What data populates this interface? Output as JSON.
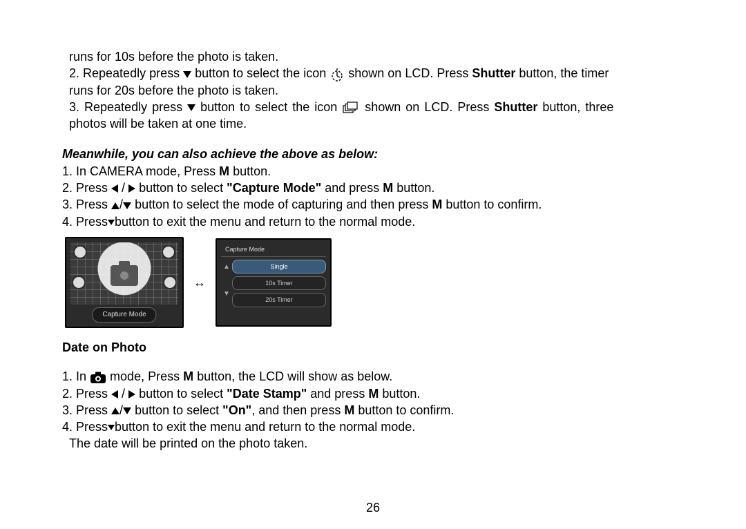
{
  "page_number": "26",
  "intro": {
    "cont1": "runs for 10s before the photo is taken.",
    "item2_a": "2. Repeatedly press ",
    "item2_b": " button to select the icon ",
    "item2_c": " shown on LCD. Press ",
    "item2_shutter": "Shutter",
    "item2_d": " button, the timer",
    "item2_e": "runs for 20s before the photo is taken.",
    "item3_a": "3. Repeatedly press ",
    "item3_b": " button to select the icon ",
    "item3_c": " shown on LCD. Press ",
    "item3_shutter": "Shutter",
    "item3_d": " button, three",
    "item3_e": "photos will be taken at one time."
  },
  "meanwhile_heading": "Meanwhile, you can also achieve the above as below:",
  "meanwhile": {
    "i1_a": "1. In CAMERA mode, Press ",
    "i1_m": "M",
    "i1_b": " button.",
    "i2_a": "2. Press ",
    "i2_b": " button to select ",
    "i2_cap": "\"Capture Mode\"",
    "i2_c": " and press ",
    "i2_m": "M",
    "i2_d": " button.",
    "i3_a": "3. Press ",
    "i3_b": " button to select the mode of capturing and then press ",
    "i3_m": "M",
    "i3_c": " button to confirm.",
    "i4_a": "4. Press",
    "i4_b": "button to exit the menu and return to the normal mode."
  },
  "figure": {
    "label1": "Capture Mode",
    "menu_header": "Capture Mode",
    "items": [
      "Single",
      "10s Timer",
      "20s Timer"
    ]
  },
  "date_heading": "Date on Photo",
  "date": {
    "i1_a": "1. In ",
    "i1_b": " mode, Press ",
    "i1_m": "M",
    "i1_c": " button, the LCD will show as below.",
    "i2_a": "2. Press ",
    "i2_b": " button to select ",
    "i2_ds": "\"Date Stamp\"",
    "i2_c": " and press ",
    "i2_m": "M",
    "i2_d": " button.",
    "i3_a": "3. Press ",
    "i3_b": " button to select ",
    "i3_on": "\"On\"",
    "i3_c": ", and then press ",
    "i3_m": "M",
    "i3_d": " button to confirm.",
    "i4_a": "4. Press",
    "i4_b": "button to exit the menu and return to the normal mode.",
    "i5": "The date will be printed on the photo taken."
  }
}
